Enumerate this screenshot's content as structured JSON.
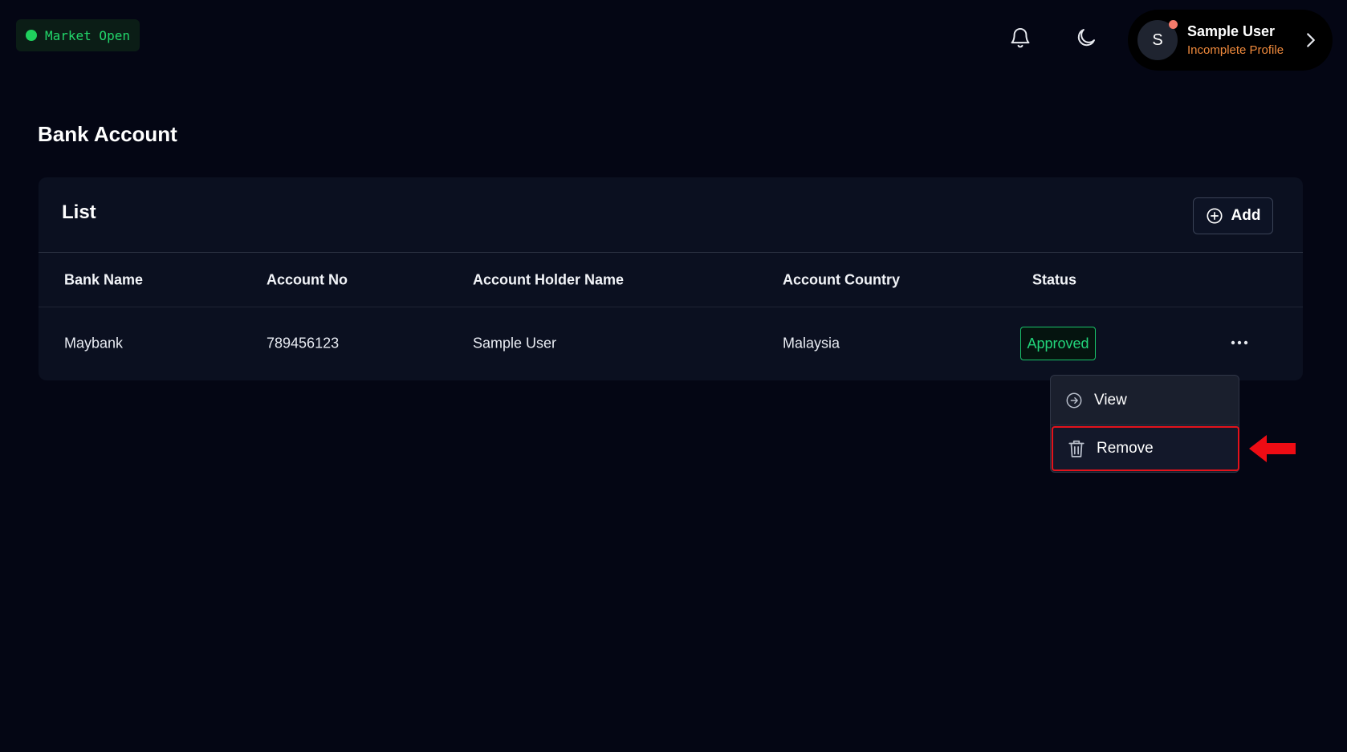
{
  "topbar": {
    "market_status": "Market Open",
    "bell_icon": "bell-icon",
    "theme_icon": "moon-icon",
    "user": {
      "initial": "S",
      "name": "Sample User",
      "subtitle": "Incomplete Profile"
    }
  },
  "page": {
    "title": "Bank Account"
  },
  "card": {
    "title": "List",
    "add_label": "Add",
    "columns": [
      "Bank Name",
      "Account No",
      "Account Holder Name",
      "Account Country",
      "Status"
    ],
    "rows": [
      {
        "bank_name": "Maybank",
        "account_no": "789456123",
        "holder_name": "Sample User",
        "country": "Malaysia",
        "status": "Approved"
      }
    ]
  },
  "menu": {
    "items": [
      {
        "label": "View",
        "icon": "arrow-right-circle-icon"
      },
      {
        "label": "Remove",
        "icon": "trash-icon"
      }
    ]
  },
  "colors": {
    "background": "#040614",
    "market_green": "#22d66a",
    "status_green": "#19c46a",
    "warning_orange": "#f08a3c",
    "highlight_red": "#e3121b"
  }
}
